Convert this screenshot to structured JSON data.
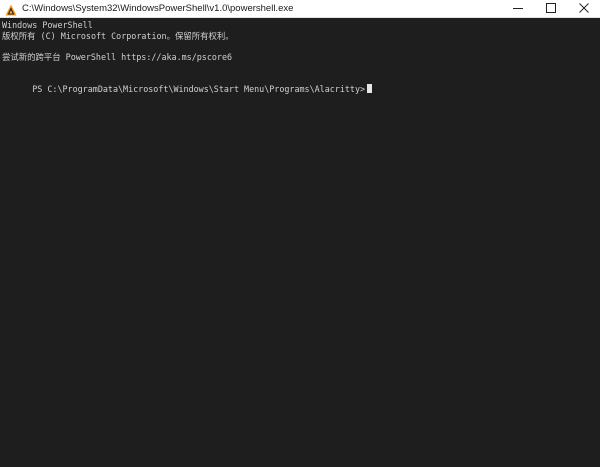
{
  "window": {
    "title": "C:\\Windows\\System32\\WindowsPowerShell\\v1.0\\powershell.exe",
    "icon": "alacritty-app-icon",
    "controls": {
      "minimize_icon": "minimize-icon",
      "maximize_icon": "maximize-icon",
      "close_icon": "close-icon"
    }
  },
  "terminal": {
    "lines": [
      "Windows PowerShell",
      "版权所有 (C) Microsoft Corporation。保留所有权利。",
      "",
      "尝试新的跨平台 PowerShell https://aka.ms/pscore6",
      ""
    ],
    "prompt": "PS C:\\ProgramData\\Microsoft\\Windows\\Start Menu\\Programs\\Alacritty>",
    "input": ""
  },
  "colors": {
    "terminal_background": "#1e1e1e",
    "terminal_foreground": "#d0d0d0",
    "titlebar_background": "#ffffff",
    "cursor": "#e6e6e6"
  }
}
